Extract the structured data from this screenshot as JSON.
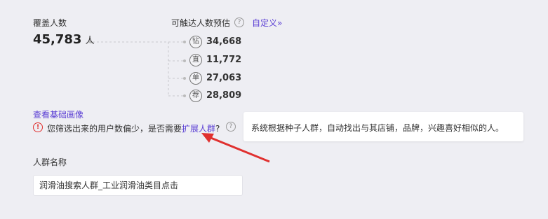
{
  "coverage": {
    "label": "覆盖人数",
    "value": "45,783",
    "unit": "人"
  },
  "reach": {
    "label": "可触达人数预估",
    "help_icon": "help-circle-icon",
    "customize_label": "自定义",
    "customize_icon": "double-chevron-right-icon",
    "items": [
      {
        "badge": "钻",
        "value": "34,668"
      },
      {
        "badge": "直",
        "value": "11,772"
      },
      {
        "badge": "单",
        "value": "27,063"
      },
      {
        "badge": "荐",
        "value": "28,809"
      }
    ]
  },
  "view_base_profile": "查看基础画像",
  "warning": {
    "icon": "alert-circle-icon",
    "text": "您筛选出来的用户数偏少，是否需要",
    "link": "扩展人群",
    "suffix": "?",
    "help_icon": "help-circle-icon",
    "color": "#e0302f"
  },
  "tooltip": {
    "text": "系统根据种子人群，自动找出与其店铺，品牌，兴趣喜好相似的人。"
  },
  "crowd_name": {
    "label": "人群名称",
    "value": "润滑油搜索人群_工业润滑油类目点击"
  },
  "annotation_arrow": {
    "color": "#e0302f"
  },
  "colors": {
    "accent": "#5b3fd4",
    "background": "#eeeef3"
  }
}
